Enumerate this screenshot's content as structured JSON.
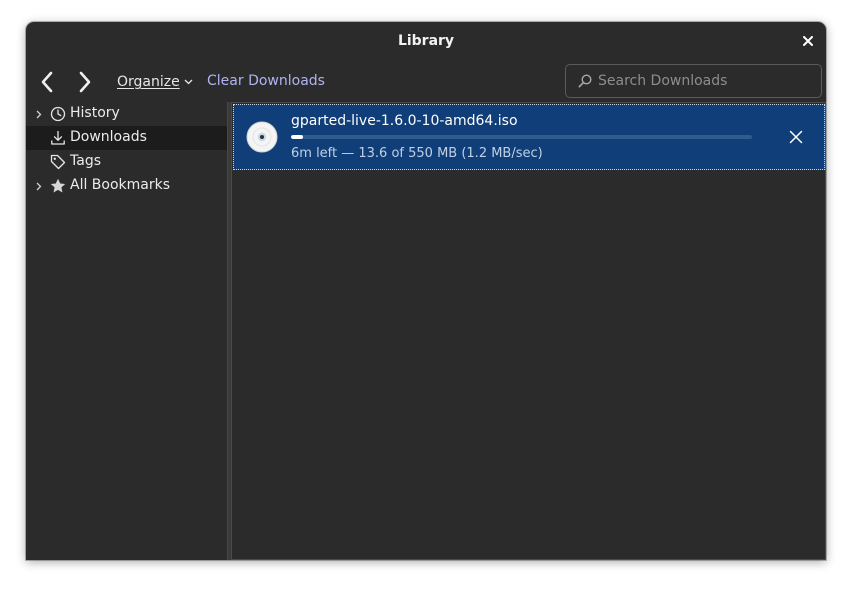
{
  "window": {
    "title": "Library"
  },
  "toolbar": {
    "organize_label": "Organize",
    "clear_downloads_label": "Clear Downloads",
    "search_placeholder": "Search Downloads"
  },
  "sidebar": {
    "items": [
      {
        "label": "History",
        "icon": "clock-icon",
        "expandable": true,
        "selected": false
      },
      {
        "label": "Downloads",
        "icon": "download-icon",
        "expandable": false,
        "selected": true
      },
      {
        "label": "Tags",
        "icon": "tag-icon",
        "expandable": false,
        "selected": false
      },
      {
        "label": "All Bookmarks",
        "icon": "star-icon",
        "expandable": true,
        "selected": false
      }
    ]
  },
  "downloads": [
    {
      "file_name": "gparted-live-1.6.0-10-amd64.iso",
      "status": "6m left — 13.6 of 550 MB (1.2 MB/sec)",
      "progress": 0.025,
      "icon": "disc-image-icon"
    }
  ],
  "colors": {
    "window_bg": "#2b2b2b",
    "selected_row": "#0f3e78",
    "link": "#aeb4f2",
    "sidebar_selected": "#1c1c1c"
  }
}
